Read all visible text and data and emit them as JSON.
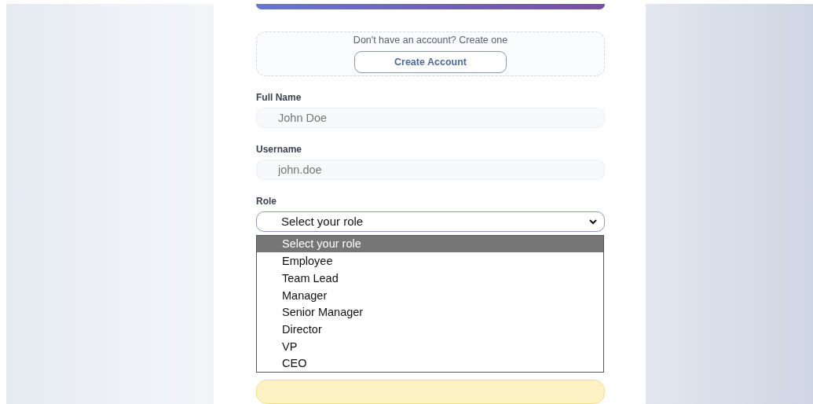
{
  "signup": {
    "prompt": "Don't have an account? Create one",
    "button": "Create Account"
  },
  "fields": [
    {
      "label": "Full Name",
      "placeholder": "John Doe"
    },
    {
      "label": "Username",
      "placeholder": "john.doe"
    }
  ],
  "role": {
    "label": "Role",
    "value": "Select your role",
    "expanded": true,
    "options": [
      {
        "label": "Select your role",
        "selected": true
      },
      {
        "label": "Employee",
        "selected": false
      },
      {
        "label": "Team Lead",
        "selected": false
      },
      {
        "label": "Manager",
        "selected": false
      },
      {
        "label": "Senior Manager",
        "selected": false
      },
      {
        "label": "Director",
        "selected": false
      },
      {
        "label": "VP",
        "selected": false
      },
      {
        "label": "CEO",
        "selected": false
      }
    ]
  }
}
